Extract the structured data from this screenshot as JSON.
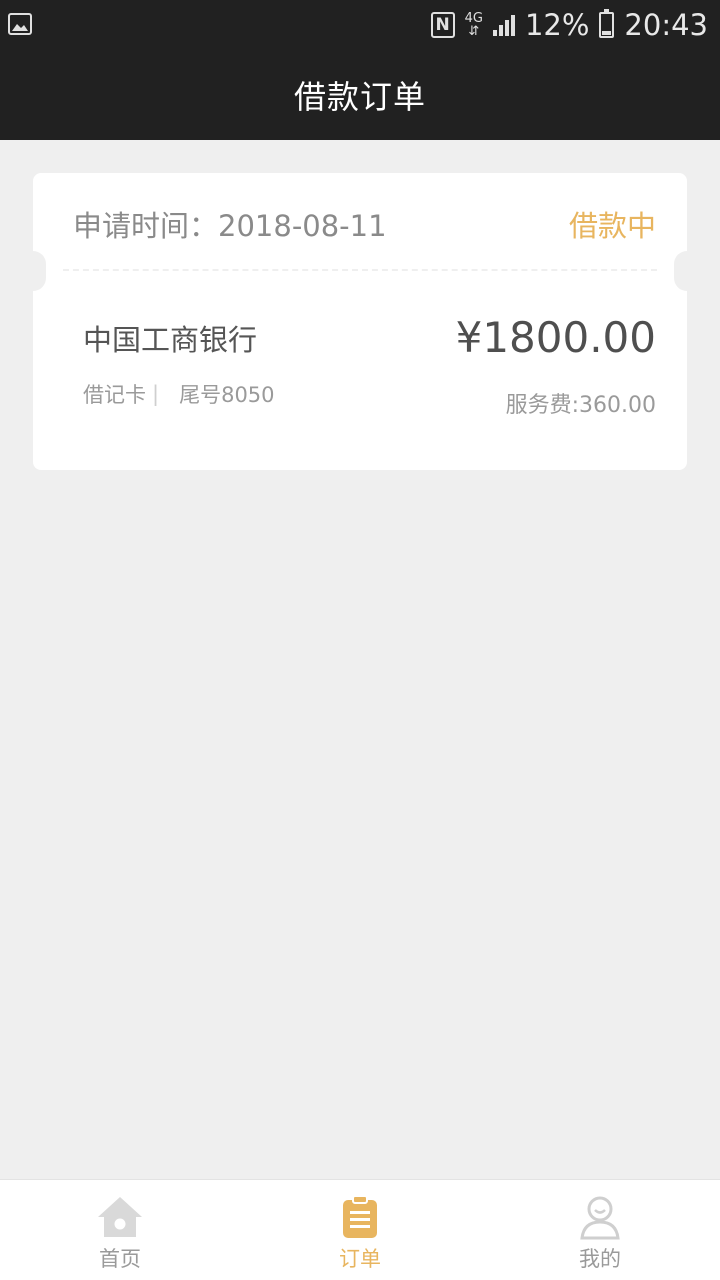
{
  "status_bar": {
    "network": "4G",
    "battery": "12%",
    "time": "20:43"
  },
  "header": {
    "title": "借款订单"
  },
  "order": {
    "apply_time_label": "申请时间：",
    "apply_date": "2018-08-11",
    "status": "借款中",
    "bank_name": "中国工商银行",
    "card_type": "借记卡",
    "card_tail": "尾号8050",
    "amount": "¥1800.00",
    "fee": "服务费:360.00"
  },
  "bottom_nav": {
    "items": [
      {
        "label": "首页",
        "icon": "home-icon",
        "active": false
      },
      {
        "label": "订单",
        "icon": "order-list-icon",
        "active": true
      },
      {
        "label": "我的",
        "icon": "user-icon",
        "active": false
      }
    ]
  },
  "colors": {
    "accent": "#e8b55f",
    "header_bg": "#212121",
    "page_bg": "#efefef"
  }
}
